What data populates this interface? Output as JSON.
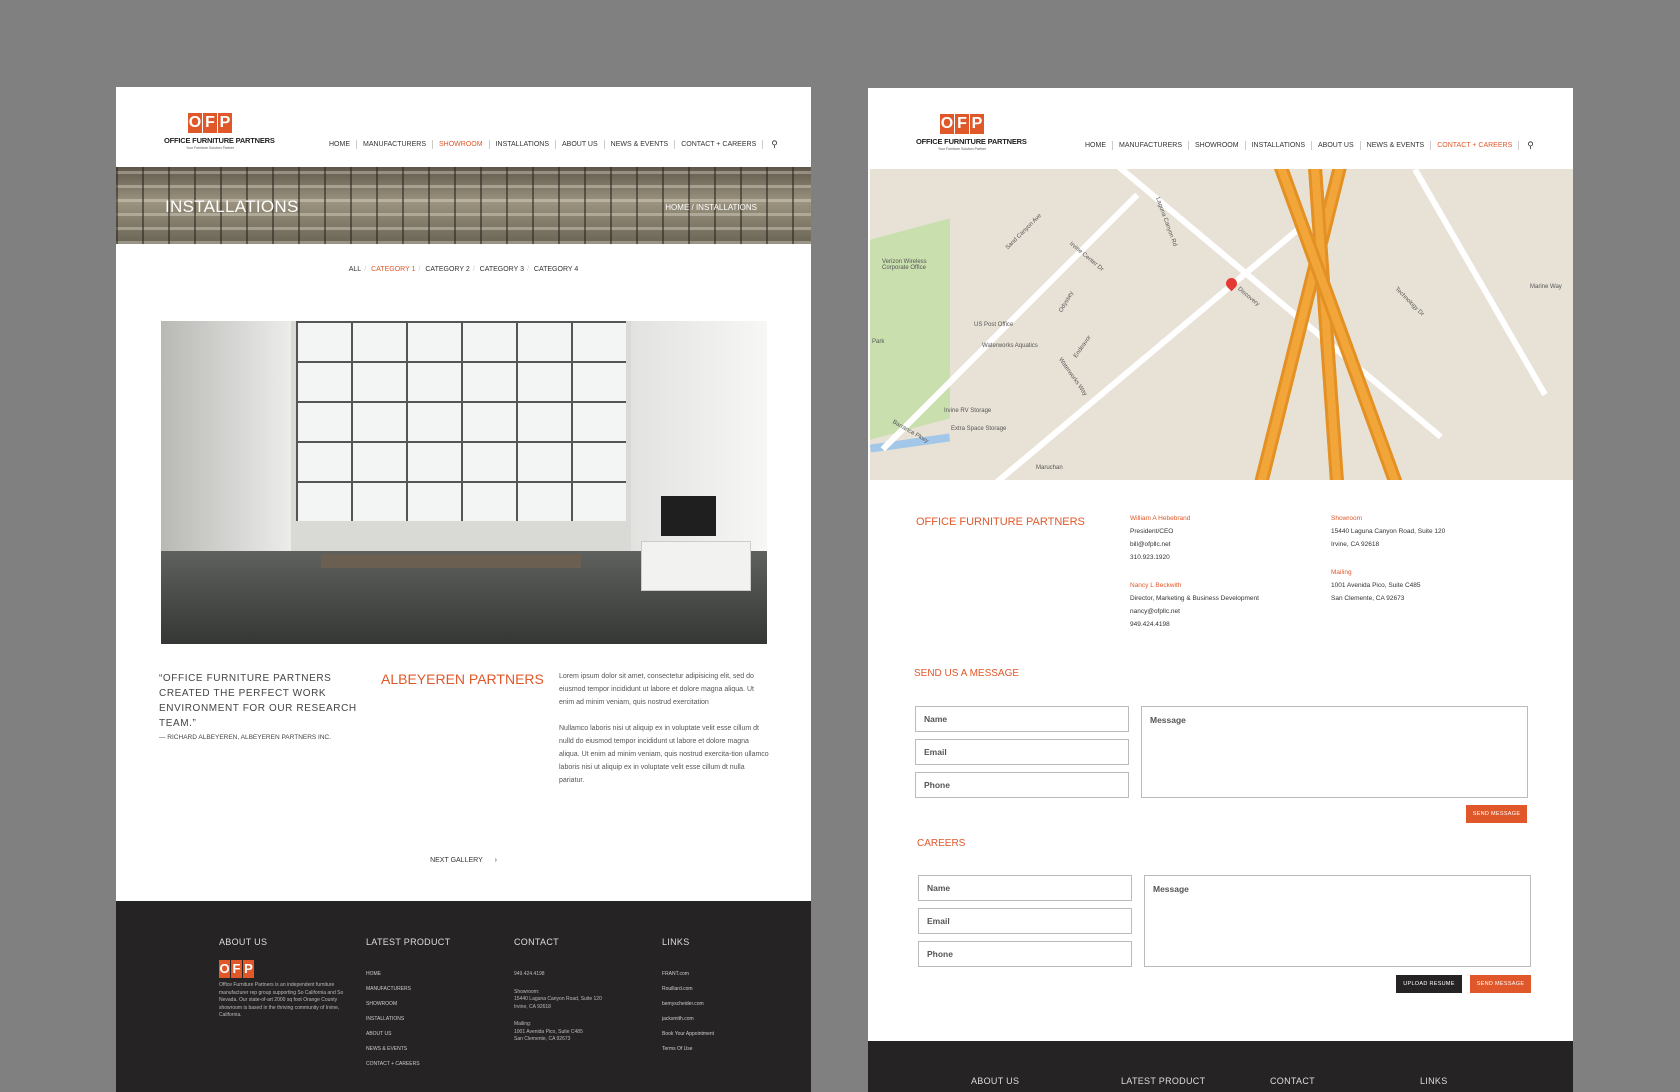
{
  "brand": {
    "logo_letters": [
      "O",
      "F",
      "P"
    ],
    "name": "OFFICE FURNITURE PARTNERS",
    "tagline": "Your Furniture Solution Partner",
    "accent_color": "#e0582a",
    "dark_color": "#262324"
  },
  "nav": {
    "items": [
      "HOME",
      "MANUFACTURERS",
      "SHOWROOM",
      "INSTALLATIONS",
      "ABOUT US",
      "NEWS & EVENTS",
      "CONTACT + CAREERS"
    ],
    "search_icon": "search-icon"
  },
  "left": {
    "banner": {
      "title": "INSTALLATIONS",
      "breadcrumb": "HOME / INSTALLATIONS"
    },
    "filters": [
      "ALL",
      "CATEGORY 1",
      "CATEGORY 2",
      "CATEGORY 3",
      "CATEGORY 4"
    ],
    "quote": "“OFFICE FURNITURE PARTNERS CREATED THE PERFECT WORK ENVIRONMENT FOR OUR RESEARCH TEAM.”",
    "quote_author": "— RICHARD ALBEYEREN, ALBEYEREN PARTNERS INC.",
    "project_title": "ALBEYEREN PARTNERS",
    "body": [
      "Lorem ipsum dolor sit amet, consectetur adipisicing elit, sed do eiusmod tempor incididunt ut labore et dolore magna aliqua. Ut enim ad minim veniam, quis nostrud exercitation",
      "Nullamco laboris nisi ut aliquip ex in voluptate velit esse cillum dt nulld do eiusmod tempor incididunt ut labore et dolore magna aliqua. Ut enim ad minim veniam, quis nostrud exercita-tion ullamco laboris nisi ut aliquip ex in voluptate velit esse cillum dt nulla pariatur."
    ],
    "next_gallery": "NEXT GALLERY",
    "next_arrow": "›"
  },
  "footer": {
    "about_title": "ABOUT US",
    "about_text": "Office Furniture Partners is an independent furniture manufacturer rep group supporting So California and So Nevada. Our state-of-art 2000 sq foot Orange County showroom is based in the thriving community of Irvine, California.",
    "product_title": "LATEST PRODUCT",
    "product_links": [
      "HOME",
      "MANUFACTURERS",
      "SHOWROOM",
      "INSTALLATIONS",
      "ABOUT US",
      "NEWS & EVENTS",
      "CONTACT + CAREERS"
    ],
    "contact_title": "CONTACT",
    "contact_phone": "949.424.4198",
    "contact_showroom_label": "Showroom:",
    "contact_showroom_1": "15440 Laguna Canyon Road, Suite 120",
    "contact_showroom_2": "Irvine, CA 92618",
    "contact_mailing_label": "Mailing:",
    "contact_mailing_1": "1001 Avenida Pico, Suite C485",
    "contact_mailing_2": "San Clemente, CA 92673",
    "links_title": "LINKS",
    "links": [
      "FRANT.com",
      "Rouillard.com",
      "bemyscheider.com",
      "jacksmith.com",
      "Book Your Appointment",
      "Terms Of Use"
    ]
  },
  "right": {
    "map": {
      "labels": [
        "Verizon Wireless Corporate Office",
        "US Post Office",
        "Waterworks Aquatics",
        "Irvine RV Storage",
        "Extra Space Storage",
        "Maruchan",
        "Marine Way",
        "Technology Dr",
        "Laguna Canyon Rd",
        "Irvine Center Dr",
        "Sand Canyon Ave",
        "Discovery",
        "Barranca Pkwy",
        "Odyssey",
        "Endeavor",
        "Waterworks Way",
        "Park"
      ],
      "pin_icon": "map-pin-icon"
    },
    "org_title": "OFFICE FURNITURE PARTNERS",
    "people": [
      {
        "name": "William A Hebebrand",
        "role": "President/CEO",
        "email": "bill@ofpllc.net",
        "phone": "310.923.1920"
      },
      {
        "name": "Nancy L Beckwith",
        "role": "Director, Marketing & Business Development",
        "email": "nancy@ofpllc.net",
        "phone": "949.424.4198"
      }
    ],
    "locations": {
      "showroom_label": "Showroom",
      "showroom_1": "15440 Laguna Canyon Road, Suite 120",
      "showroom_2": "Irvine, CA 92618",
      "mailing_label": "Mailing",
      "mailing_1": "1001 Avenida Pico, Suite C485",
      "mailing_2": "San Clemente, CA 92673"
    },
    "message_form": {
      "title": "SEND US A MESSAGE",
      "name_placeholder": "Name",
      "email_placeholder": "Email",
      "phone_placeholder": "Phone",
      "message_placeholder": "Message",
      "send_label": "SEND MESSAGE"
    },
    "careers_form": {
      "title": "CAREERS",
      "name_placeholder": "Name",
      "email_placeholder": "Email",
      "phone_placeholder": "Phone",
      "message_placeholder": "Message",
      "upload_label": "UPLOAD RESUME",
      "send_label": "SEND MESSAGE"
    }
  }
}
